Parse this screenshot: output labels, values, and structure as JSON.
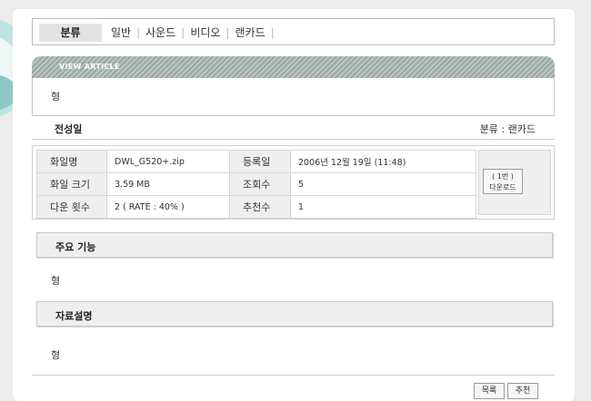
{
  "category_bar": {
    "title": "분류",
    "items": [
      "일반",
      "사운드",
      "비디오",
      "랜카드"
    ]
  },
  "article": {
    "header": "VIEW ARTICLE",
    "title": "형",
    "author": "전성일",
    "category_label": "분류 : 랜카드"
  },
  "file_info": {
    "filename_label": "화일명",
    "filename": "DWL_G520+.zip",
    "filesize_label": "화일 크기",
    "filesize": "3.59 MB",
    "downloads_label": "다운 횟수",
    "downloads": "2 ( RATE : 40% )",
    "date_label": "등록일",
    "date": "2006년 12월 19일 (11:48)",
    "views_label": "조회수",
    "views": "5",
    "recommend_label": "추천수",
    "recommend": "1",
    "download_button": {
      "count": "( 1번 )",
      "label": "다운로드"
    }
  },
  "sections": {
    "features_title": "주요 기능",
    "features_body": "형",
    "description_title": "자료설명",
    "description_body": "형"
  },
  "buttons": {
    "list": "목록",
    "recommend": "추천"
  }
}
